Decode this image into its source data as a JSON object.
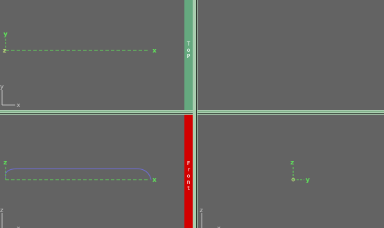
{
  "viewports": {
    "top_left": {
      "axes": {
        "y": "y",
        "z": "z",
        "x": "x"
      },
      "gizmo": {
        "y": "y",
        "x": "x"
      }
    },
    "top_right": {},
    "bottom_left": {
      "axes": {
        "z": "z",
        "x": "x"
      },
      "gizmo": {
        "z": "z",
        "x": "x"
      }
    },
    "bottom_right": {
      "axes": {
        "z": "z",
        "y": "y"
      },
      "gizmo": {
        "z": "z",
        "x": "x"
      }
    }
  },
  "labels": {
    "top": [
      "T",
      "o",
      "P"
    ],
    "front": [
      "F",
      "r",
      "o",
      "n",
      "t"
    ]
  },
  "colors": {
    "viewport_bg": "#636363",
    "axis_green": "#5fe15a",
    "curve_blue": "#6f6ee0",
    "top_label_bg": "#65a97f",
    "front_label_bg": "#d30000",
    "separator": "#a9ceaf"
  }
}
